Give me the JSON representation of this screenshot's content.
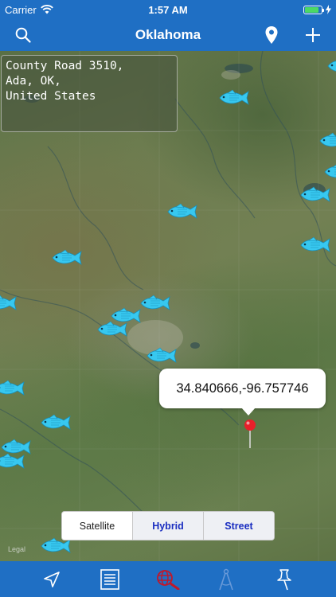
{
  "status_bar": {
    "carrier": "Carrier",
    "time": "1:57 AM",
    "battery_level": 0.85
  },
  "nav": {
    "title": "Oklahoma",
    "left_icon": "search-icon",
    "right_icons": [
      "location-pin-icon",
      "plus-icon"
    ]
  },
  "address": {
    "lines": [
      "County Road 3510,",
      "Ada, OK,",
      "United States"
    ]
  },
  "callout": {
    "coordinates": "34.840666,-96.757746"
  },
  "map_type": {
    "options": [
      "Satellite",
      "Hybrid",
      "Street"
    ],
    "selected": "Satellite"
  },
  "legal": "Legal",
  "tab_bar": {
    "items": [
      "navigate-arrow-icon",
      "list-icon",
      "globe-search-icon",
      "compass-icon",
      "pushpin-icon"
    ]
  },
  "colors": {
    "bar_blue": "#1f6fc4",
    "fish_cyan": "#37c8f0",
    "segment_text": "#1a2ec0"
  }
}
